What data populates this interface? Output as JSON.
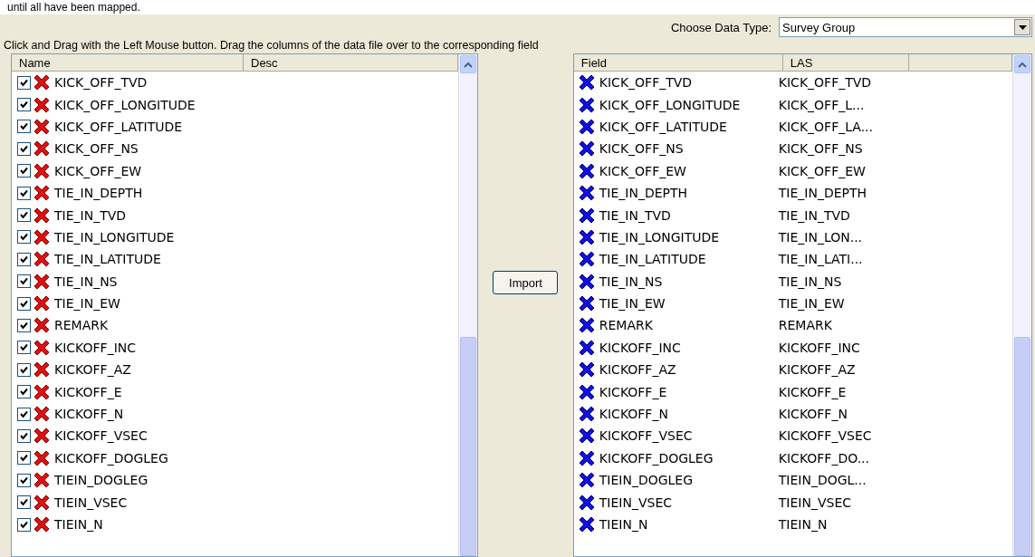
{
  "top_note": "until all have been mapped.",
  "data_type": {
    "label": "Choose Data Type:",
    "value": "Survey Group"
  },
  "instruction": "Click and Drag with the Left Mouse button. Drag the columns of the data file over to the corresponding field",
  "source_list": {
    "columns": [
      "Name",
      "Desc"
    ],
    "rows": [
      {
        "name": "KICK_OFF_TVD",
        "checked": true
      },
      {
        "name": "KICK_OFF_LONGITUDE",
        "checked": true
      },
      {
        "name": "KICK_OFF_LATITUDE",
        "checked": true
      },
      {
        "name": "KICK_OFF_NS",
        "checked": true
      },
      {
        "name": "KICK_OFF_EW",
        "checked": true
      },
      {
        "name": "TIE_IN_DEPTH",
        "checked": true
      },
      {
        "name": "TIE_IN_TVD",
        "checked": true
      },
      {
        "name": "TIE_IN_LONGITUDE",
        "checked": true
      },
      {
        "name": "TIE_IN_LATITUDE",
        "checked": true
      },
      {
        "name": "TIE_IN_NS",
        "checked": true
      },
      {
        "name": "TIE_IN_EW",
        "checked": true
      },
      {
        "name": "REMARK",
        "checked": true
      },
      {
        "name": "KICKOFF_INC",
        "checked": true
      },
      {
        "name": "KICKOFF_AZ",
        "checked": true
      },
      {
        "name": "KICKOFF_E",
        "checked": true
      },
      {
        "name": "KICKOFF_N",
        "checked": true
      },
      {
        "name": "KICKOFF_VSEC",
        "checked": true
      },
      {
        "name": "KICKOFF_DOGLEG",
        "checked": true
      },
      {
        "name": "TIEIN_DOGLEG",
        "checked": true
      },
      {
        "name": "TIEIN_VSEC",
        "checked": true
      },
      {
        "name": "TIEIN_N",
        "checked": true
      }
    ]
  },
  "import_button": "Import",
  "field_list": {
    "columns": [
      "Field",
      "LAS"
    ],
    "rows": [
      {
        "field": "KICK_OFF_TVD",
        "las": "KICK_OFF_TVD"
      },
      {
        "field": "KICK_OFF_LONGITUDE",
        "las": "KICK_OFF_L..."
      },
      {
        "field": "KICK_OFF_LATITUDE",
        "las": "KICK_OFF_LA..."
      },
      {
        "field": "KICK_OFF_NS",
        "las": "KICK_OFF_NS"
      },
      {
        "field": "KICK_OFF_EW",
        "las": "KICK_OFF_EW"
      },
      {
        "field": "TIE_IN_DEPTH",
        "las": "TIE_IN_DEPTH"
      },
      {
        "field": "TIE_IN_TVD",
        "las": "TIE_IN_TVD"
      },
      {
        "field": "TIE_IN_LONGITUDE",
        "las": "TIE_IN_LON..."
      },
      {
        "field": "TIE_IN_LATITUDE",
        "las": "TIE_IN_LATI..."
      },
      {
        "field": "TIE_IN_NS",
        "las": "TIE_IN_NS"
      },
      {
        "field": "TIE_IN_EW",
        "las": "TIE_IN_EW"
      },
      {
        "field": "REMARK",
        "las": "REMARK"
      },
      {
        "field": "KICKOFF_INC",
        "las": "KICKOFF_INC"
      },
      {
        "field": "KICKOFF_AZ",
        "las": "KICKOFF_AZ"
      },
      {
        "field": "KICKOFF_E",
        "las": "KICKOFF_E"
      },
      {
        "field": "KICKOFF_N",
        "las": "KICKOFF_N"
      },
      {
        "field": "KICKOFF_VSEC",
        "las": "KICKOFF_VSEC"
      },
      {
        "field": "KICKOFF_DOGLEG",
        "las": "KICKOFF_DO..."
      },
      {
        "field": "TIEIN_DOGLEG",
        "las": "TIEIN_DOGL..."
      },
      {
        "field": "TIEIN_VSEC",
        "las": "TIEIN_VSEC"
      },
      {
        "field": "TIEIN_N",
        "las": "TIEIN_N"
      }
    ]
  }
}
